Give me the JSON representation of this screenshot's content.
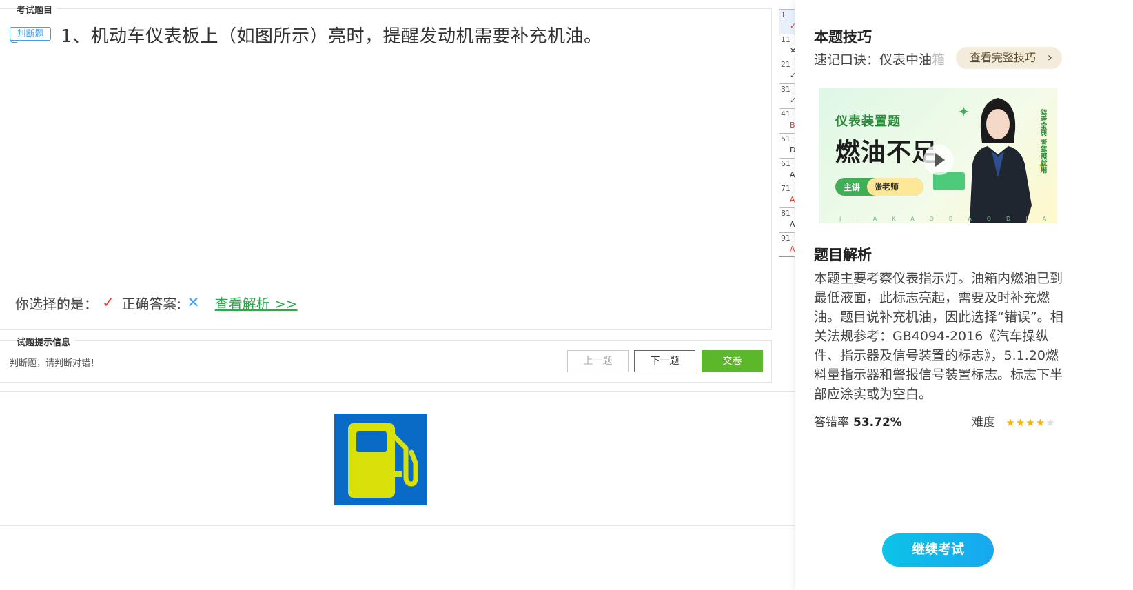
{
  "exam": {
    "section_title": "考试题目",
    "question_type_badge": "判断题",
    "question_text": "1、机动车仪表板上（如图所示）亮时，提醒发动机需要补充机油。",
    "your_choice_label": "你选择的是：",
    "your_choice_icon": "check-icon",
    "correct_answer_label": "正确答案:",
    "correct_answer_icon": "cross-icon",
    "view_analysis_link": "查看解析 >>"
  },
  "hint": {
    "section_title": "试题提示信息",
    "text": "判断题，请判断对错！",
    "prev_button": "上一题",
    "next_button": "下一题",
    "submit_button": "交卷"
  },
  "question_image": {
    "icon": "fuel-pump-icon",
    "bg_color": "#0a6bc6",
    "fg_color": "#d8e20a"
  },
  "answer_grid": [
    {
      "num": "1",
      "mark": "✓",
      "mark_color": "#e53935",
      "active": true
    },
    {
      "num": "11",
      "mark": "✕",
      "mark_color": "#333"
    },
    {
      "num": "21",
      "mark": "✓",
      "mark_color": "#333"
    },
    {
      "num": "31",
      "mark": "✓",
      "mark_color": "#333"
    },
    {
      "num": "41",
      "mark": "B",
      "mark_color": "#e53935"
    },
    {
      "num": "51",
      "mark": "D",
      "mark_color": "#333"
    },
    {
      "num": "61",
      "mark": "A",
      "mark_color": "#333"
    },
    {
      "num": "71",
      "mark": "A",
      "mark_color": "#e53935"
    },
    {
      "num": "81",
      "mark": "A",
      "mark_color": "#333"
    },
    {
      "num": "91",
      "mark": "A",
      "mark_color": "#e53935"
    }
  ],
  "sidebar": {
    "tips_title": "本题技巧",
    "tip_prefix": "速记口诀：仪表中油",
    "tip_fade": "箱",
    "tip_button": "查看完整技巧",
    "banner": {
      "tag": "仪表装置题",
      "headline": "燃油不足",
      "lecturer_label": "主讲",
      "lecturer_name": "张老师",
      "vertical_text": "驾考宝典 考驾照就用",
      "spell": "JIAKAOBAODIAN"
    },
    "analysis_title": "题目解析",
    "analysis_text": "本题主要考察仪表指示灯。油箱内燃油已到最低液面，此标志亮起，需要及时补充燃油。题目说补充机油，因此选择“错误”。相关法规参考：GB4094-2016《汽车操纵件、指示器及信号装置的标志》，5.1.20燃料量指示器和警报信号装置标志。标志下半部应涂实或为空白。",
    "error_rate_label": "答错率",
    "error_rate_value": "53.72%",
    "difficulty_label": "难度",
    "difficulty_stars": 4,
    "difficulty_max": 5,
    "continue_button": "继续考试"
  }
}
